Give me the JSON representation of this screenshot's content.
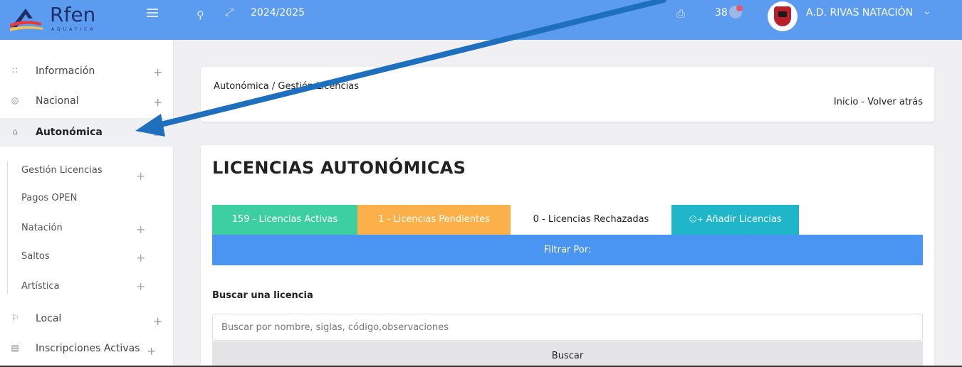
{
  "header": {
    "logo_text": "Rfen",
    "logo_subtext": "AQUATICA",
    "season": "2024/2025",
    "notification_count": "38",
    "club_name": "A.D. RIVAS NATACIÓN",
    "colors": {
      "bar": "#5c9cf0",
      "logo": "#1e2f66"
    }
  },
  "sidebar": {
    "items": [
      {
        "label": "Información",
        "icon": "grid-icon"
      },
      {
        "label": "Nacional",
        "icon": "globe-icon"
      },
      {
        "label": "Autonómica",
        "icon": "home-icon",
        "active": true
      },
      {
        "label": "Local",
        "icon": "flag-icon"
      },
      {
        "label": "Inscripciones Activas",
        "icon": "clipboard-icon"
      }
    ],
    "subitems": [
      {
        "label": "Gestión Licencias"
      },
      {
        "label": "Pagos OPEN"
      },
      {
        "label": "Natación"
      },
      {
        "label": "Saltos"
      },
      {
        "label": "Artística"
      }
    ],
    "plus": "+",
    "minus": "−"
  },
  "breadcrumb": {
    "path": "Autonómica / Gestión Licencias",
    "back": "Inicio - Volver atrás"
  },
  "main": {
    "title": "LICENCIAS AUTONÓMICAS",
    "tabs": {
      "active": "159 - Licencias Activas",
      "pending": "1 - Licencias Pendientes",
      "rejected": "0 - Licencias Rechazadas",
      "add": "Añadir Licencias"
    },
    "filter_label": "Filtrar Por:",
    "search_label": "Buscar una licencia",
    "search_placeholder": "Buscar por nombre, siglas, código,observaciones",
    "search_button": "Buscar",
    "colors": {
      "green": "#3ecfa0",
      "orange": "#fcb04a",
      "cyan": "#1eb6c8",
      "blue": "#4a95f2"
    }
  },
  "annotation": {
    "color": "#1f6fbf"
  }
}
